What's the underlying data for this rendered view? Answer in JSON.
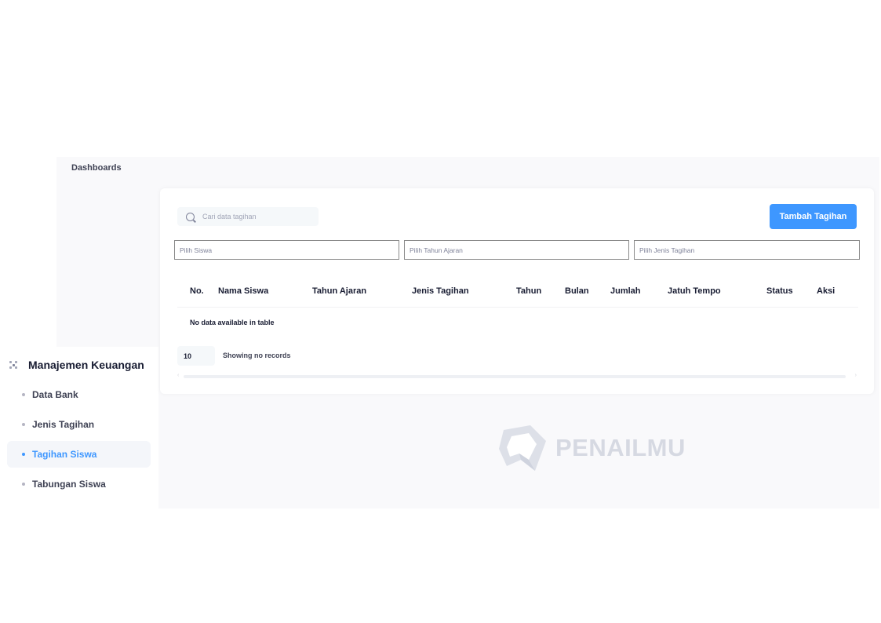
{
  "breadcrumb": {
    "label": "Dashboards"
  },
  "toolbar": {
    "search_placeholder": "Cari data tagihan",
    "add_button_label": "Tambah Tagihan"
  },
  "filters": {
    "siswa_placeholder": "Pilih Siswa",
    "tahun_ajaran_placeholder": "Pilih Tahun Ajaran",
    "jenis_tagihan_placeholder": "Pilih Jenis Tagihan"
  },
  "table": {
    "columns": [
      "No.",
      "Nama Siswa",
      "Tahun Ajaran",
      "Jenis Tagihan",
      "Tahun",
      "Bulan",
      "Jumlah",
      "Jatuh Tempo",
      "Status",
      "Aksi"
    ],
    "empty_message": "No data available in table",
    "page_length": "10",
    "info": "Showing no records"
  },
  "sidebar": {
    "section_label": "Manajemen Keuangan",
    "items": [
      {
        "label": "Data Bank",
        "active": false
      },
      {
        "label": "Jenis Tagihan",
        "active": false
      },
      {
        "label": "Tagihan Siswa",
        "active": true
      },
      {
        "label": "Tabungan Siswa",
        "active": false
      }
    ]
  },
  "watermark": {
    "text": "PENAILMU"
  },
  "colors": {
    "accent": "#3e97ff",
    "page_background": "#f9f9fb",
    "active_menu_background": "#f4f6fa",
    "watermark": "#d6d9e2"
  }
}
